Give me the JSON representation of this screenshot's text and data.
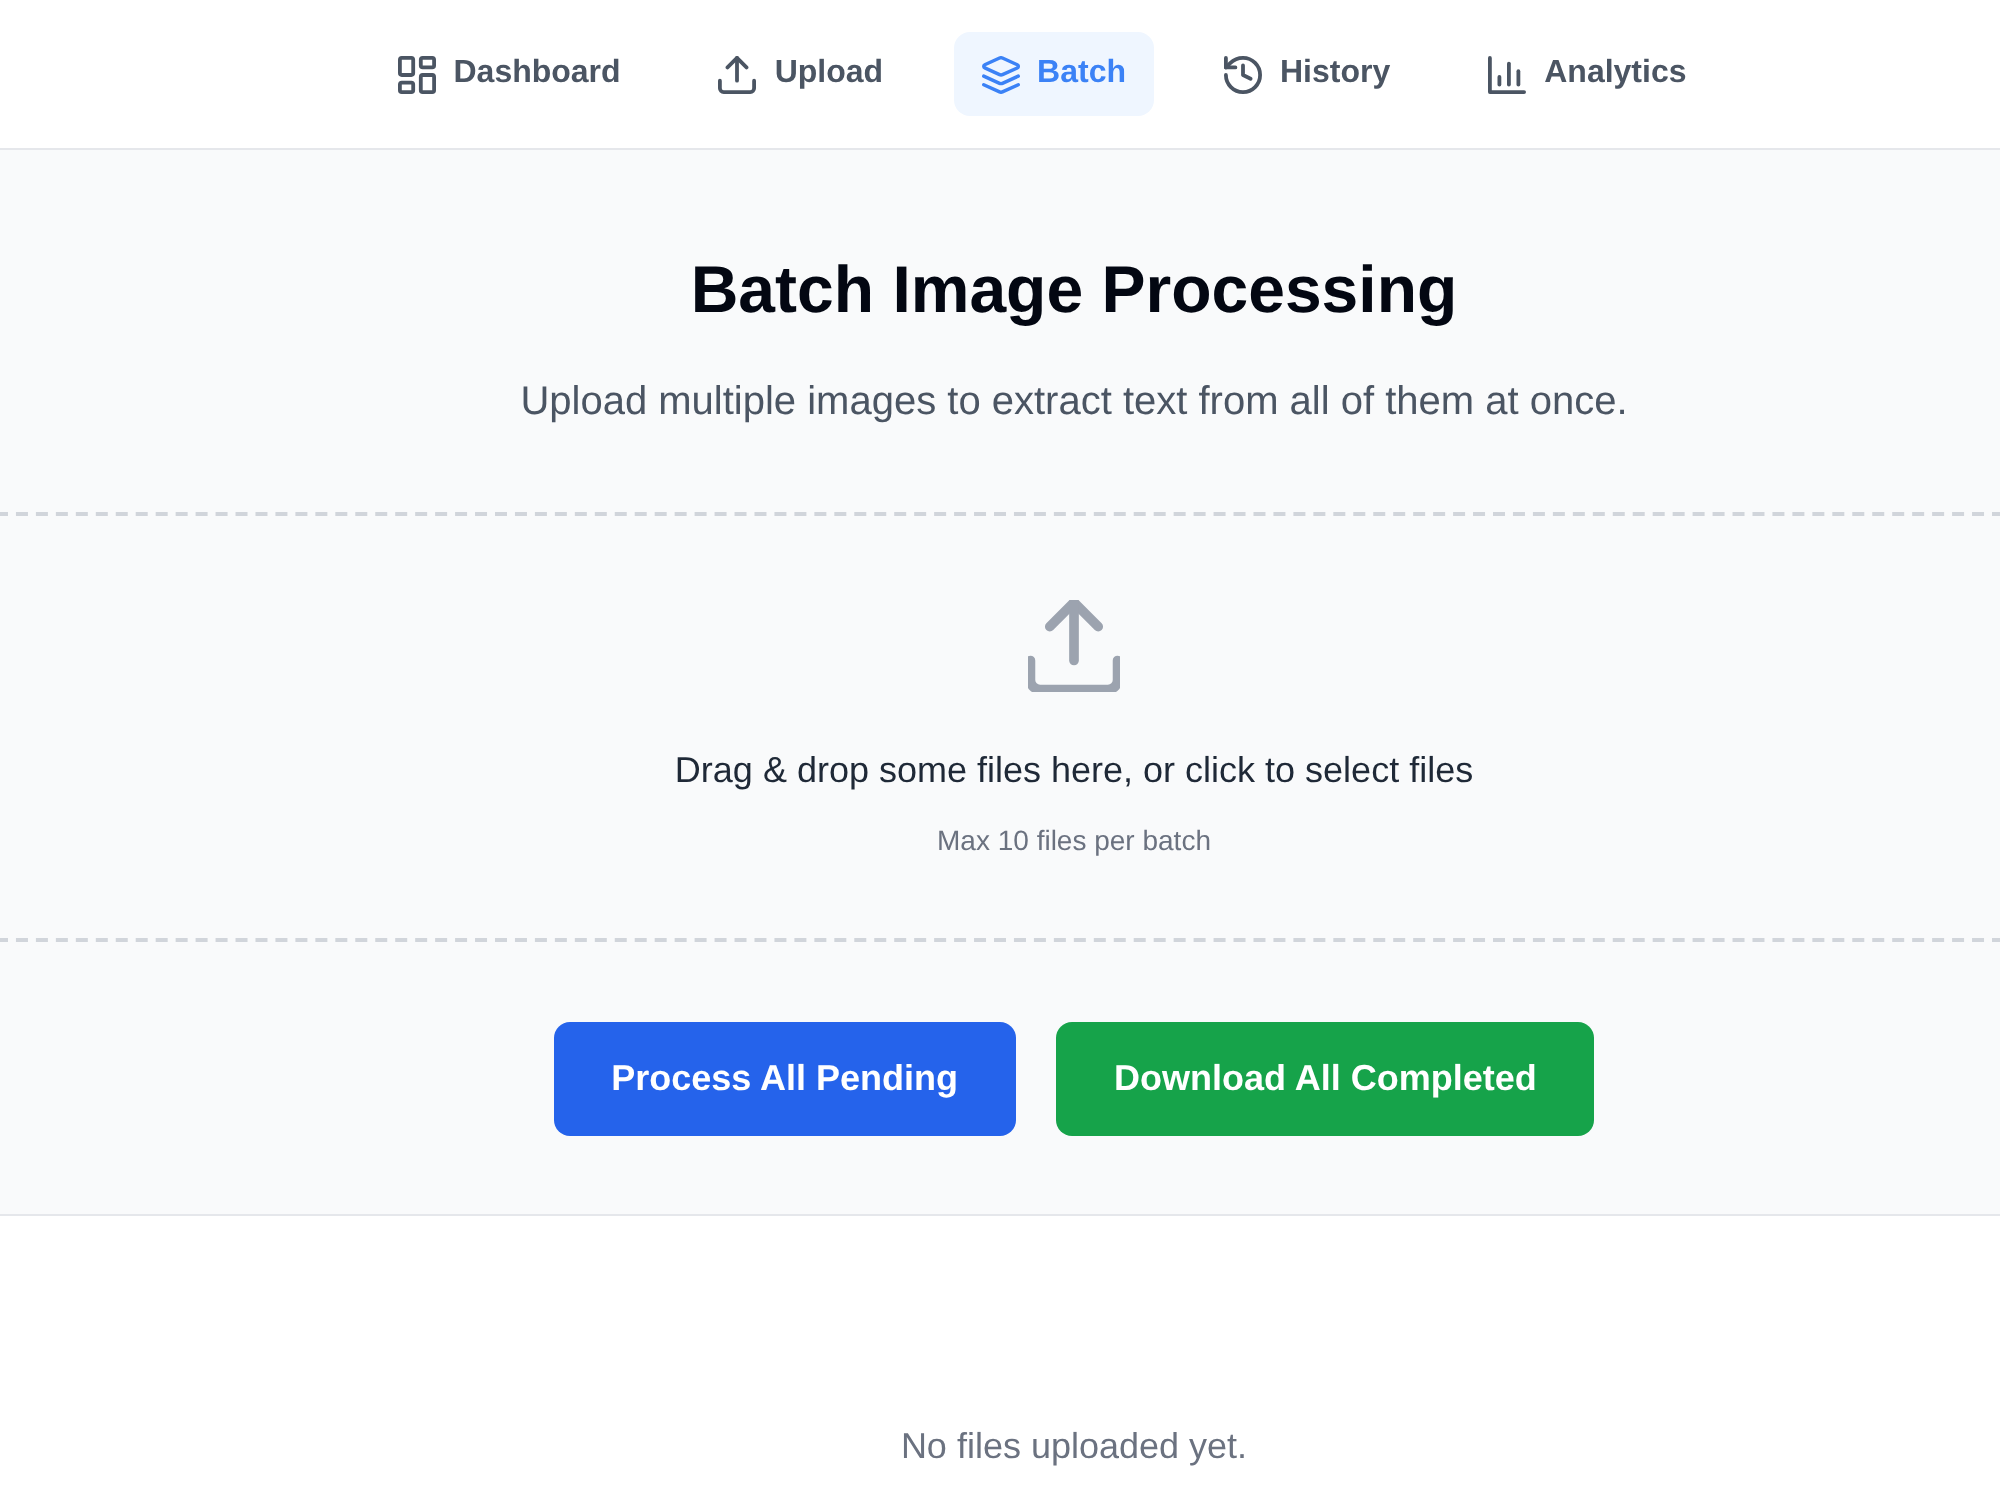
{
  "nav": {
    "items": [
      {
        "label": "Dashboard",
        "selected": false
      },
      {
        "label": "Upload",
        "selected": false
      },
      {
        "label": "Batch",
        "selected": true
      },
      {
        "label": "History",
        "selected": false
      },
      {
        "label": "Analytics",
        "selected": false
      }
    ]
  },
  "header": {
    "title": "Batch Image Processing",
    "subtitle": "Upload multiple images to extract text from all of them at once."
  },
  "dropzone": {
    "prompt": "Drag & drop some files here, or click to select files",
    "hint": "Max 10 files per batch"
  },
  "actions": [
    {
      "label": "Process All Pending",
      "kind": "primary"
    },
    {
      "label": "Download All Completed",
      "kind": "success"
    }
  ],
  "file_list": {
    "empty_message": "No files uploaded yet."
  }
}
